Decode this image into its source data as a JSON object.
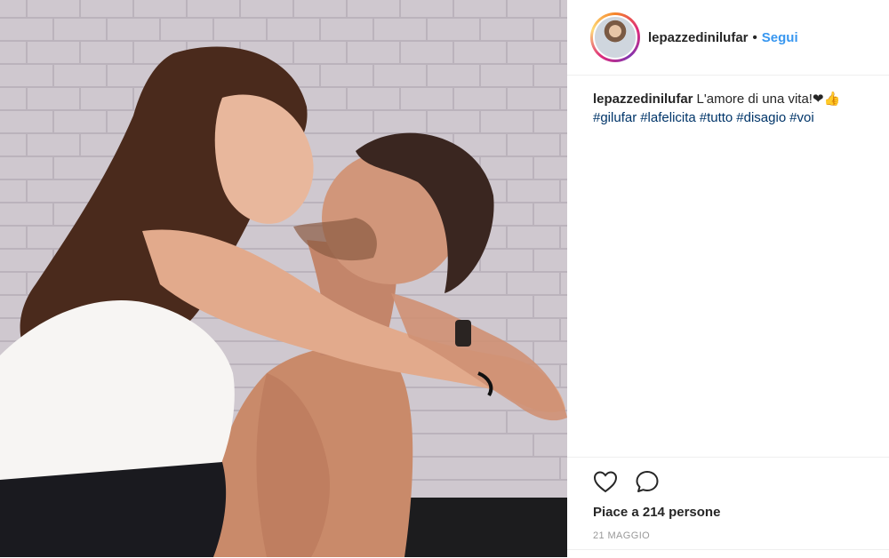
{
  "post": {
    "username": "lepazzedinilufar",
    "separator": "•",
    "follow_label": "Segui",
    "caption_text": "L'amore di una vita!❤👍",
    "hashtags": [
      "#gilufar",
      "#lafelicita",
      "#tutto",
      "#disagio",
      "#voi"
    ],
    "likes_text": "Piace a 214 persone",
    "date_text": "21 MAGGIO"
  },
  "icons": {
    "like": "heart-icon",
    "comment": "comment-bubble-icon"
  },
  "colors": {
    "follow": "#3897f0",
    "hashtag": "#003569",
    "date": "#999999",
    "text": "#262626"
  }
}
